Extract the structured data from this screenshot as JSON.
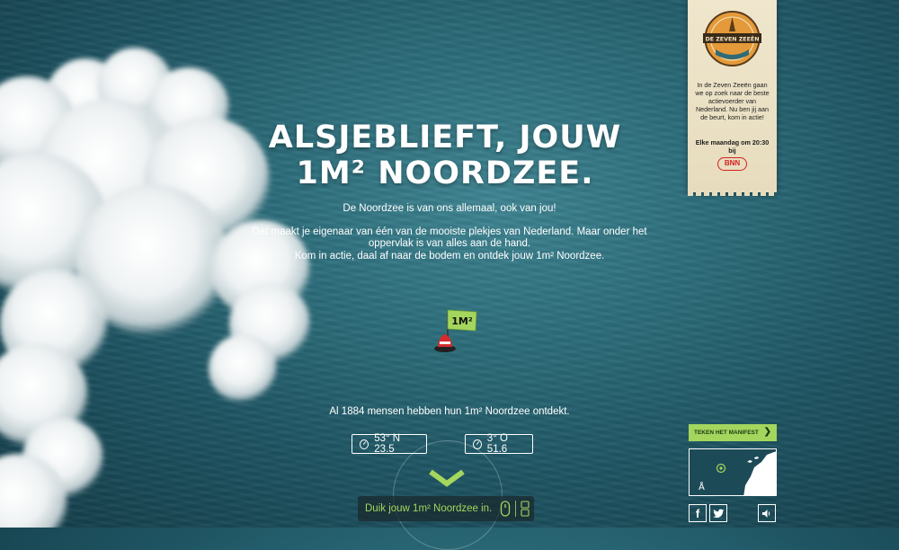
{
  "headline": {
    "line1": "ALSJEBLIEFT, JOUW",
    "line2": "1M² NOORDZEE."
  },
  "intro": {
    "p1": "De Noordzee is van ons allemaal, ook van jou!",
    "p2_line1": "Dat maakt je eigenaar van één van de mooiste plekjes van Nederland. Maar onder het oppervlak is van alles aan de hand.",
    "p2_line2": "Kom in actie, daal af naar de bodem en ontdek jouw 1m² Noordzee."
  },
  "buoy": {
    "flag_label": "1M²"
  },
  "counter": {
    "text": "Al 1884 mensen hebben hun 1m² Noordzee ontdekt."
  },
  "coords": {
    "north": "53° N 23.5",
    "east": "3° O 51.6"
  },
  "dive": {
    "label": "Duik jouw 1m² Noordzee in."
  },
  "banner": {
    "logo_text": "DE ZEVEN ZEEËN",
    "description": "In de Zeven Zeeën gaan we op zoek naar de beste actievoerder van Nederland. Nu ben jij aan de beurt, kom in actie!",
    "schedule": "Elke maandag om 20:30 bij",
    "broadcaster": "BNN"
  },
  "manifest": {
    "label": "TEKEN HET MANIFEST",
    "arrow": "❯"
  },
  "social": {
    "facebook": "f",
    "twitter": "twitter-icon",
    "sound": "sound-icon"
  },
  "colors": {
    "accent": "#a4d65e",
    "sea": "#2d6e7c",
    "banner": "#efe6cd"
  }
}
